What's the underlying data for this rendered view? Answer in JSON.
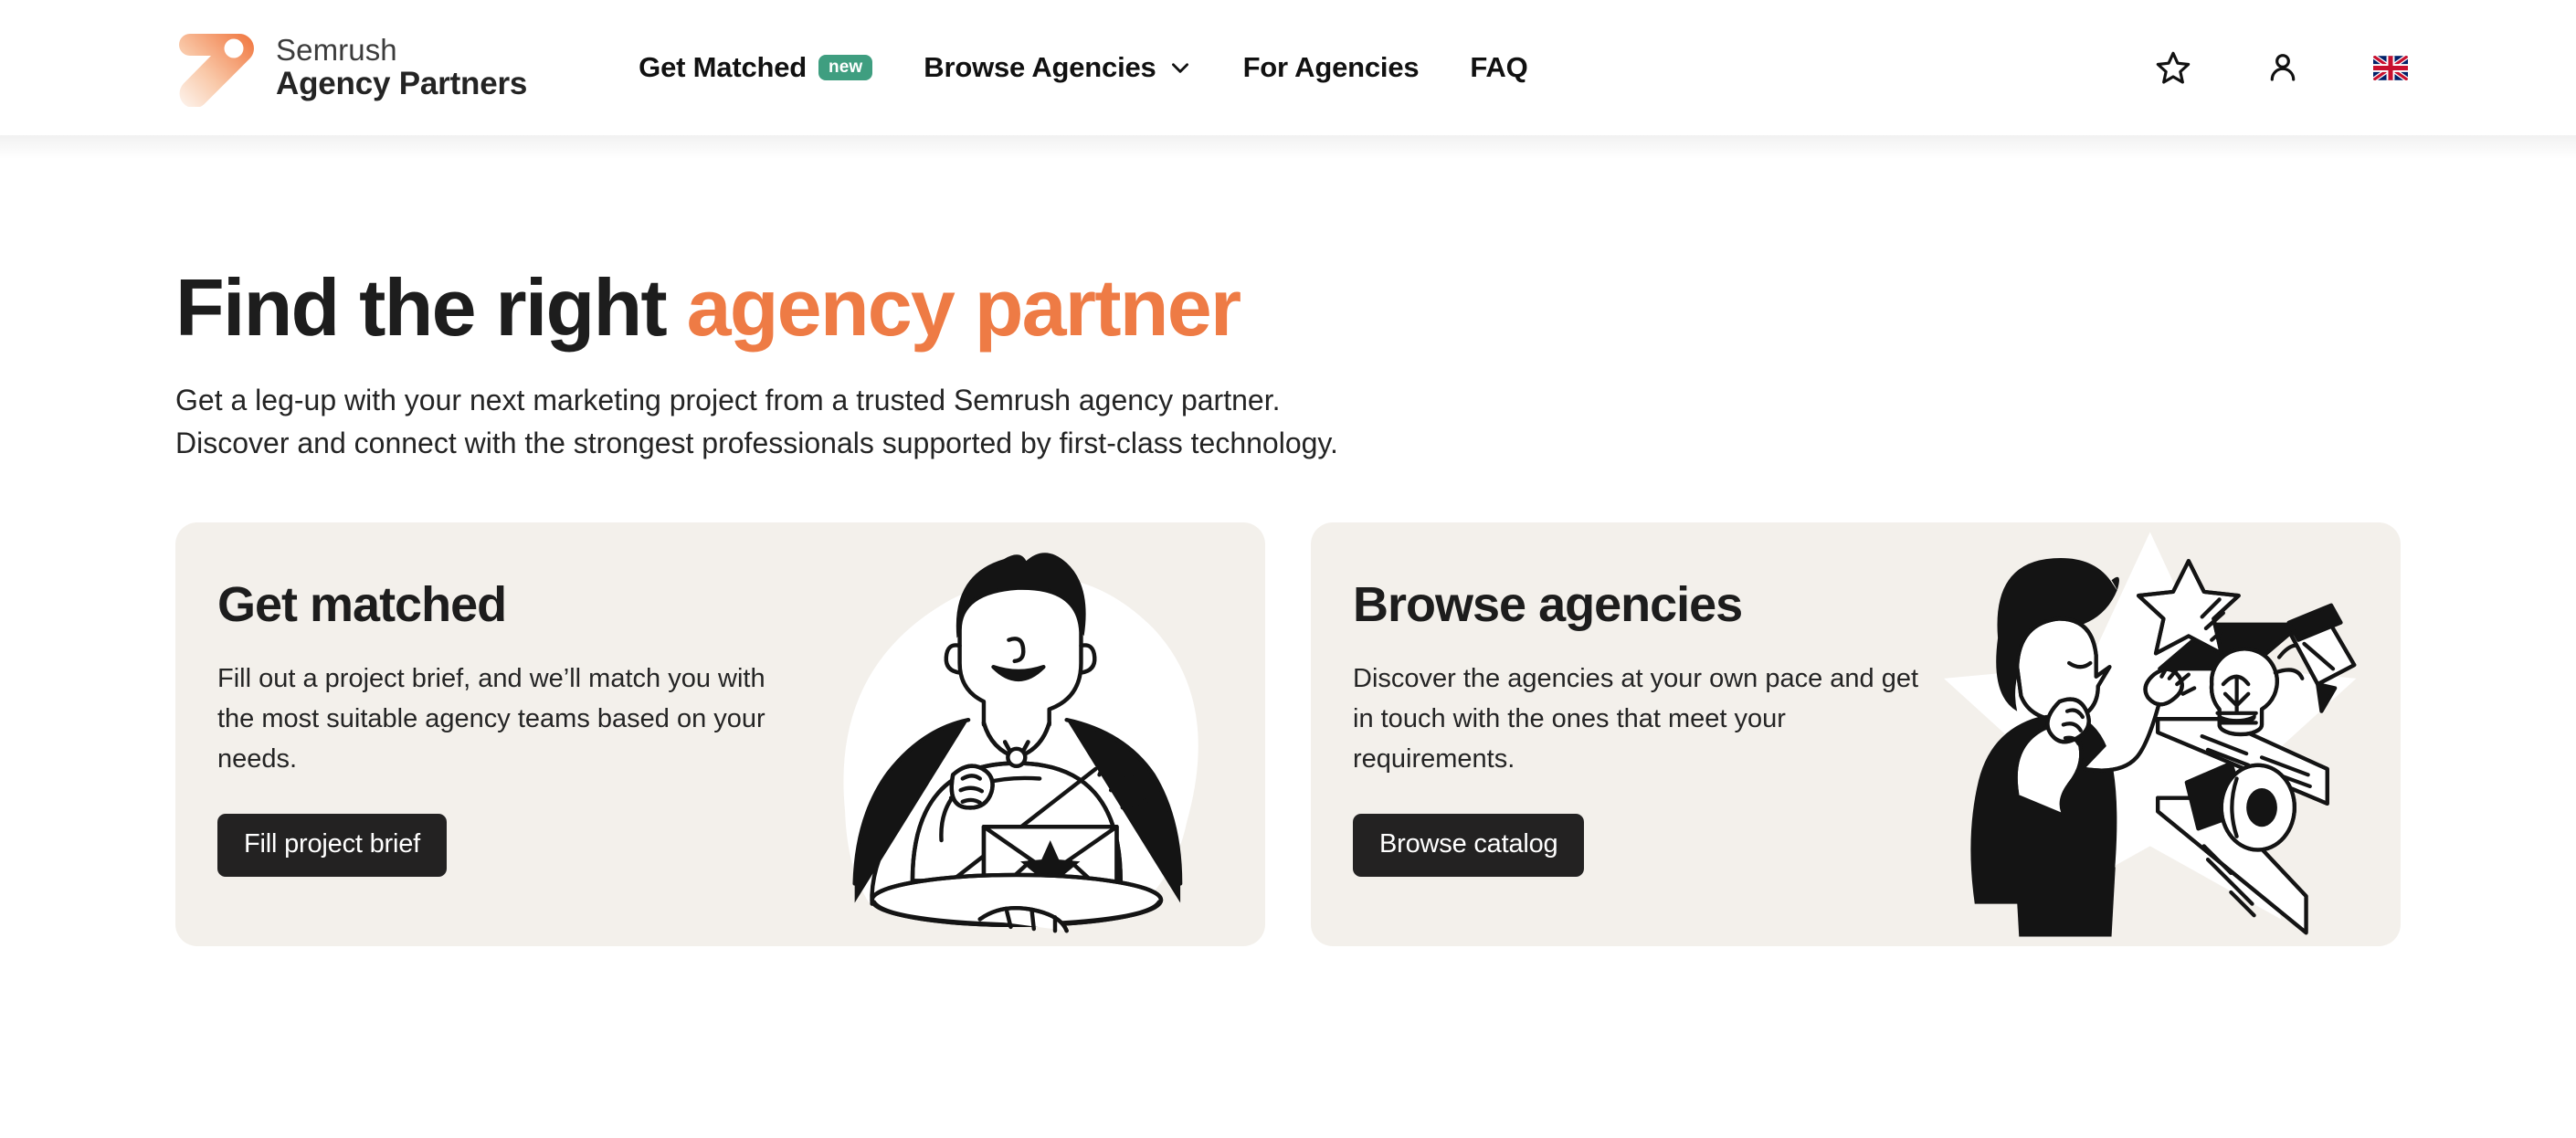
{
  "header": {
    "logo": {
      "icon_name": "semrush-logo-icon",
      "line1": "Semrush",
      "line2": "Agency Partners",
      "gradient_from": "#fdf3ee",
      "gradient_to": "#f0743c"
    },
    "nav": [
      {
        "label": "Get Matched",
        "badge": "new",
        "badge_color": "#3f9e80",
        "has_chevron": false
      },
      {
        "label": "Browse Agencies",
        "badge": null,
        "has_chevron": true
      },
      {
        "label": "For Agencies",
        "badge": null,
        "has_chevron": false
      },
      {
        "label": "FAQ",
        "badge": null,
        "has_chevron": false
      }
    ],
    "actions": {
      "favorites_icon": "star-icon",
      "account_icon": "user-icon",
      "language_icon": "uk-flag-icon"
    }
  },
  "hero": {
    "title_plain": "Find the right ",
    "title_accent": "agency partner",
    "accent_color": "#ee7b45",
    "sub_line1": "Get a leg-up with your next marketing project from a trusted Semrush agency partner.",
    "sub_line2": "Discover and connect with the strongest professionals supported by first-class technology."
  },
  "cards": [
    {
      "title": "Get matched",
      "desc": "Fill out a project brief, and we’ll match you with the most suitable agency teams based on your needs.",
      "button": "Fill project brief",
      "illustration": "waiter-serving-envelope-illustration",
      "bg": "#f3f0eb"
    },
    {
      "title": "Browse agencies",
      "desc": "Discover the agencies at your own pace and get in touch with the ones that meet your requirements.",
      "button": "Browse catalog",
      "illustration": "person-browsing-shelves-illustration",
      "bg": "#f3f0eb"
    }
  ]
}
